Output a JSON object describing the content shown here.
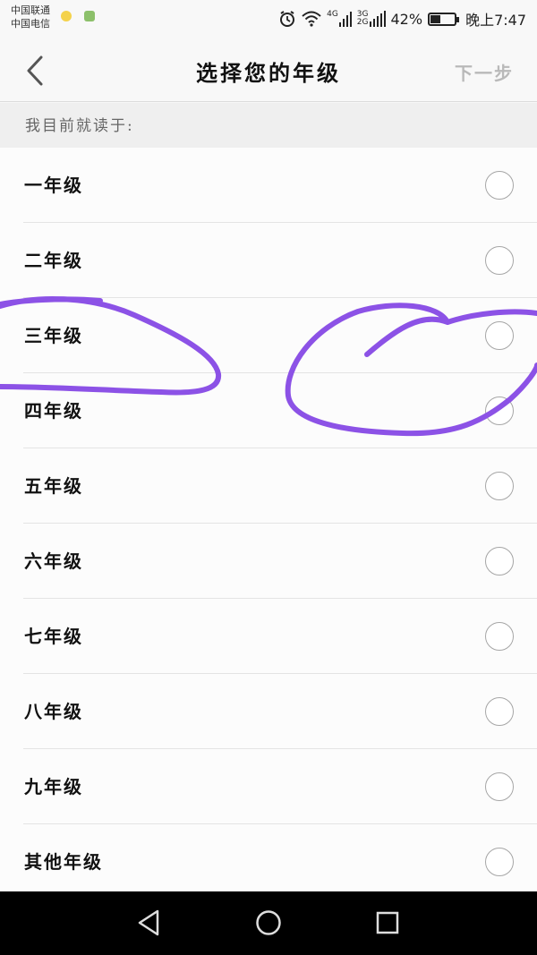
{
  "status_bar": {
    "carrier_1": "中国联通",
    "carrier_2": "中国电信",
    "network_1": "4G",
    "network_2_top": "3G",
    "network_2_bottom": "2G",
    "battery_percent_label": "42%",
    "battery_level": 0.42,
    "time": "晚上7:47",
    "icons": [
      "yellow-dot-icon",
      "app-notification-icon",
      "alarm-icon",
      "wifi-icon",
      "signal-icon",
      "battery-icon"
    ]
  },
  "header": {
    "back_icon": "chevron-left-icon",
    "title": "选择您的年级",
    "next_label": "下一步"
  },
  "section_caption": "我目前就读于:",
  "grades": [
    {
      "label": "一年级",
      "selected": false
    },
    {
      "label": "二年级",
      "selected": false
    },
    {
      "label": "三年级",
      "selected": false
    },
    {
      "label": "四年级",
      "selected": false
    },
    {
      "label": "五年级",
      "selected": false
    },
    {
      "label": "六年级",
      "selected": false
    },
    {
      "label": "七年级",
      "selected": false
    },
    {
      "label": "八年级",
      "selected": false
    },
    {
      "label": "九年级",
      "selected": false
    },
    {
      "label": "其他年级",
      "selected": false
    }
  ],
  "system_nav": {
    "icons": [
      "back-triangle-icon",
      "home-circle-icon",
      "recents-square-icon"
    ]
  },
  "colors": {
    "annotation": "#8c52e6",
    "next_disabled": "#b9b9b9",
    "divider": "#e4e4e4"
  }
}
